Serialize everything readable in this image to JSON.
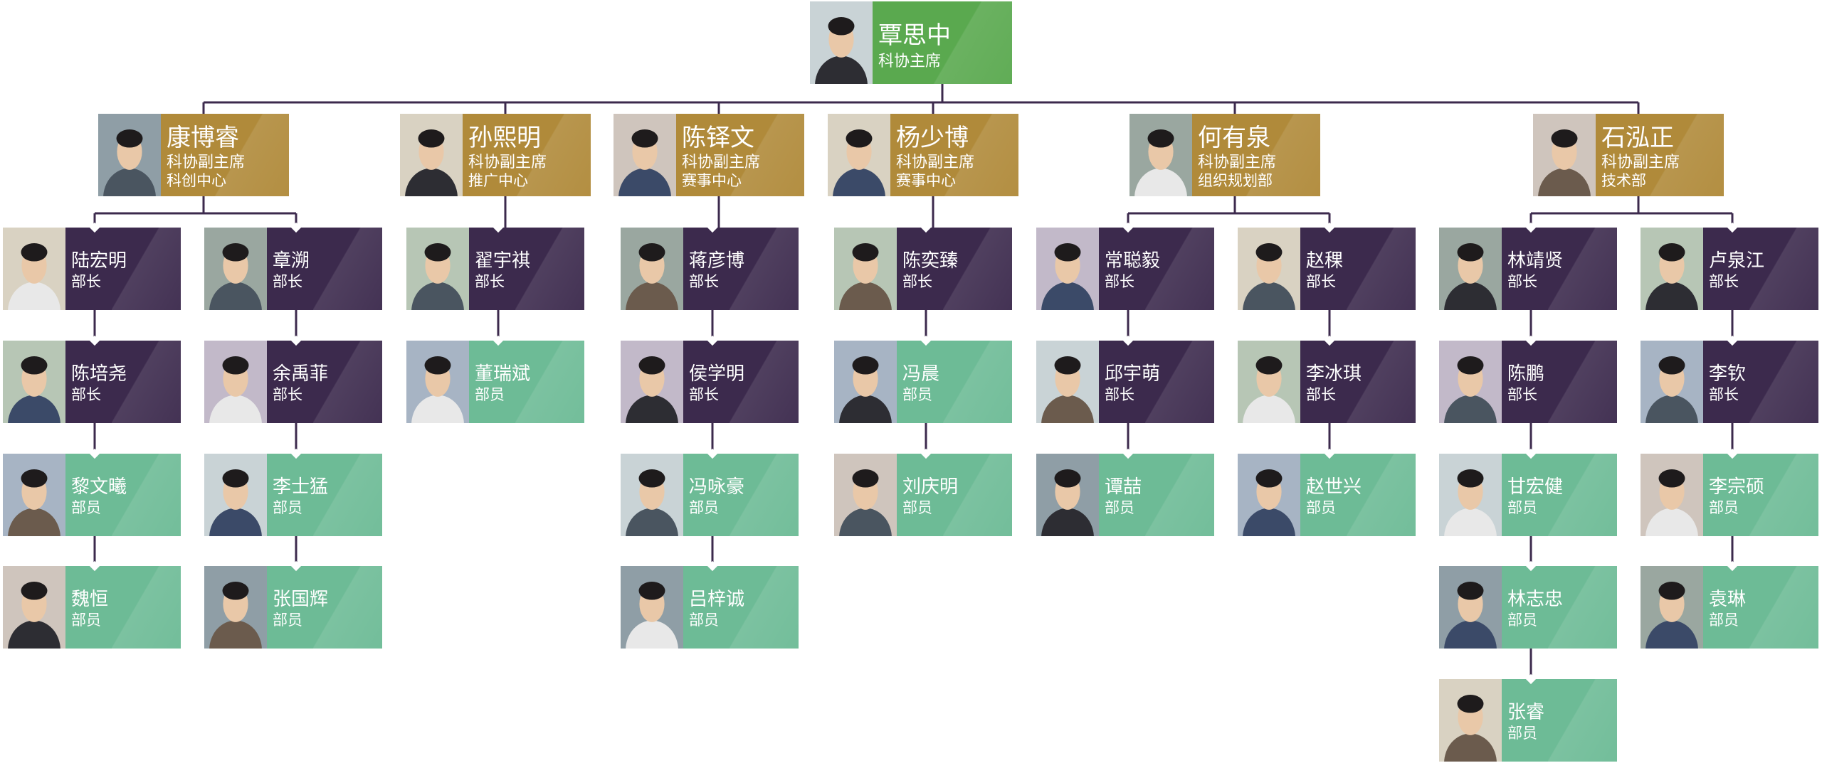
{
  "colors": {
    "top": "#5aa94f",
    "vice": "#b08a3a",
    "head": "#3c2a4d",
    "member": "#6dbb96",
    "line": "#3c2a4d"
  },
  "chart_data": {
    "type": "org-chart",
    "root": {
      "name": "覃思中",
      "role": "科协主席",
      "children": [
        {
          "name": "康博睿",
          "role": "科协副主席",
          "dept": "科创中心",
          "columns": [
            [
              {
                "name": "陆宏明",
                "role": "部长"
              },
              {
                "name": "陈培尧",
                "role": "部长"
              },
              {
                "name": "黎文曦",
                "role": "部员"
              },
              {
                "name": "魏恒",
                "role": "部员"
              }
            ],
            [
              {
                "name": "章溯",
                "role": "部长"
              },
              {
                "name": "余禹菲",
                "role": "部长"
              },
              {
                "name": "李士猛",
                "role": "部员"
              },
              {
                "name": "张国辉",
                "role": "部员"
              }
            ]
          ]
        },
        {
          "name": "孙熙明",
          "role": "科协副主席",
          "dept": "推广中心",
          "columns": [
            [
              {
                "name": "翟宇祺",
                "role": "部长"
              },
              {
                "name": "董瑞斌",
                "role": "部员"
              }
            ]
          ]
        },
        {
          "name": "陈铎文",
          "role": "科协副主席",
          "dept": "赛事中心",
          "columns": [
            [
              {
                "name": "蒋彦博",
                "role": "部长"
              },
              {
                "name": "侯学明",
                "role": "部长"
              },
              {
                "name": "冯咏豪",
                "role": "部员"
              },
              {
                "name": "吕梓诚",
                "role": "部员"
              }
            ]
          ]
        },
        {
          "name": "杨少博",
          "role": "科协副主席",
          "dept": "赛事中心",
          "columns": [
            [
              {
                "name": "陈奕臻",
                "role": "部长"
              },
              {
                "name": "冯晨",
                "role": "部员"
              },
              {
                "name": "刘庆明",
                "role": "部员"
              }
            ]
          ]
        },
        {
          "name": "何有泉",
          "role": "科协副主席",
          "dept": "组织规划部",
          "columns": [
            [
              {
                "name": "常聪毅",
                "role": "部长"
              },
              {
                "name": "邱宇萌",
                "role": "部长"
              },
              {
                "name": "谭喆",
                "role": "部员"
              }
            ],
            [
              {
                "name": "赵稞",
                "role": "部长"
              },
              {
                "name": "李冰琪",
                "role": "部长"
              },
              {
                "name": "赵世兴",
                "role": "部员"
              }
            ]
          ]
        },
        {
          "name": "石泓正",
          "role": "科协副主席",
          "dept": "技术部",
          "columns": [
            [
              {
                "name": "林靖贤",
                "role": "部长"
              },
              {
                "name": "陈鹏",
                "role": "部长"
              },
              {
                "name": "甘宏健",
                "role": "部员"
              },
              {
                "name": "林志忠",
                "role": "部员"
              },
              {
                "name": "张睿",
                "role": "部员"
              }
            ],
            [
              {
                "name": "卢泉江",
                "role": "部长"
              },
              {
                "name": "李钦",
                "role": "部长"
              },
              {
                "name": "李宗硕",
                "role": "部员"
              },
              {
                "name": "袁琳",
                "role": "部员"
              }
            ]
          ]
        }
      ]
    }
  }
}
